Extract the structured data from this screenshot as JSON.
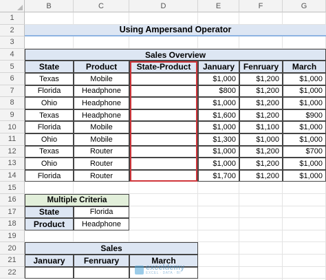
{
  "columns": [
    "B",
    "C",
    "D",
    "E",
    "F",
    "G"
  ],
  "rows": [
    "1",
    "2",
    "3",
    "4",
    "5",
    "6",
    "7",
    "8",
    "9",
    "10",
    "11",
    "12",
    "13",
    "14",
    "15",
    "16",
    "17",
    "18",
    "19",
    "20",
    "21",
    "22"
  ],
  "title": "Using Ampersand Operator",
  "sales_overview": {
    "heading": "Sales Overview",
    "headers": [
      "State",
      "Product",
      "State-Product",
      "January",
      "Fenruary",
      "March"
    ],
    "rows": [
      [
        "Texas",
        "Mobile",
        "",
        "$1,000",
        "$1,200",
        "$1,000"
      ],
      [
        "Florida",
        "Headphone",
        "",
        "$800",
        "$1,200",
        "$1,000"
      ],
      [
        "Ohio",
        "Headphone",
        "",
        "$1,000",
        "$1,200",
        "$1,000"
      ],
      [
        "Texas",
        "Headphone",
        "",
        "$1,600",
        "$1,200",
        "$900"
      ],
      [
        "Florida",
        "Mobile",
        "",
        "$1,000",
        "$1,100",
        "$1,000"
      ],
      [
        "Ohio",
        "Mobile",
        "",
        "$1,300",
        "$1,000",
        "$1,000"
      ],
      [
        "Texas",
        "Router",
        "",
        "$1,000",
        "$1,200",
        "$700"
      ],
      [
        "Ohio",
        "Router",
        "",
        "$1,000",
        "$1,200",
        "$1,000"
      ],
      [
        "Florida",
        "Router",
        "",
        "$1,700",
        "$1,200",
        "$1,000"
      ]
    ]
  },
  "multiple_criteria": {
    "heading": "Multiple Criteria",
    "rows": [
      {
        "label": "State",
        "value": "Florida"
      },
      {
        "label": "Product",
        "value": "Headphone"
      }
    ]
  },
  "sales": {
    "heading": "Sales",
    "headers": [
      "January",
      "Fenruary",
      "March"
    ]
  },
  "watermark": {
    "name": "exceldemy",
    "tagline": "EXCEL · DATA · BI"
  },
  "colors": {
    "header_fill": "#dde6f3",
    "criteria_fill": "#e2efda",
    "highlight": "#d0353a"
  }
}
